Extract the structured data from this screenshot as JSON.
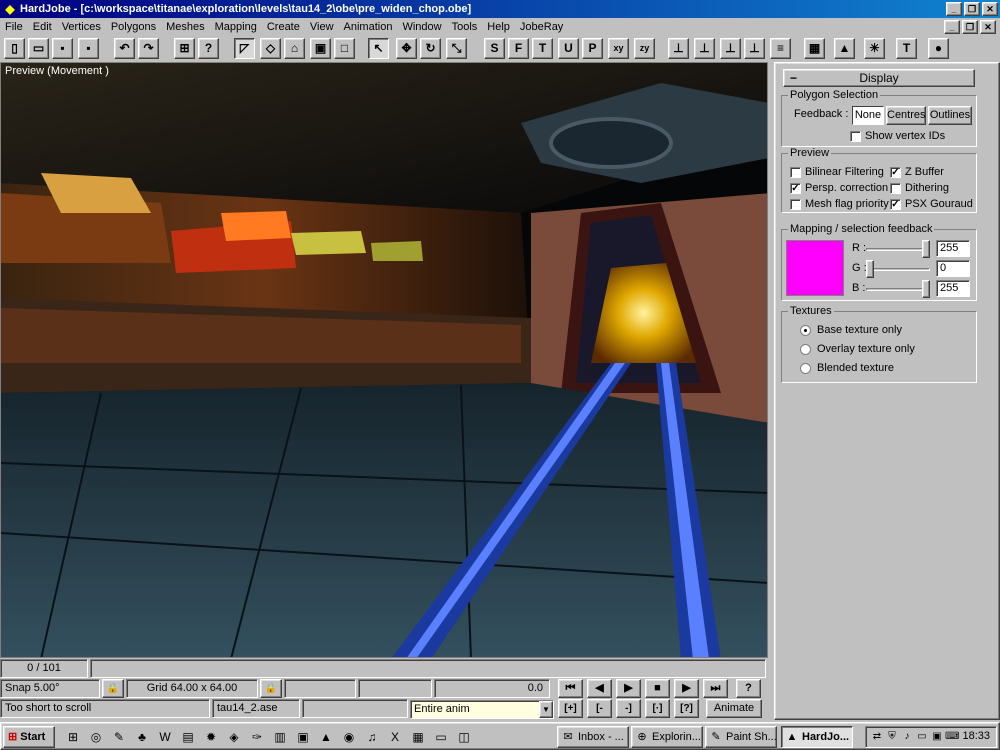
{
  "window": {
    "title": "HardJobe - [c:\\workspace\\titanae\\exploration\\levels\\tau14_2\\obe\\pre_widen_chop.obe]",
    "app_icon": "hardjobe-icon",
    "controls": [
      "_",
      "❐",
      "✕"
    ]
  },
  "menu": {
    "items": [
      "File",
      "Edit",
      "Vertices",
      "Polygons",
      "Meshes",
      "Mapping",
      "Create",
      "View",
      "Animation",
      "Window",
      "Tools",
      "Help",
      "JobeRay"
    ],
    "doc_controls": [
      "_",
      "❐",
      "✕"
    ]
  },
  "toolbar": {
    "buttons": [
      {
        "icon": "new-file-icon",
        "glyph": "▯"
      },
      {
        "icon": "open-folder-icon",
        "glyph": "▭"
      },
      {
        "icon": "save-icon",
        "glyph": "▪"
      },
      {
        "icon": "save-all-icon",
        "glyph": "▪"
      },
      {
        "icon": "undo-icon",
        "glyph": "↶"
      },
      {
        "icon": "redo-icon",
        "glyph": "↷"
      },
      {
        "icon": "texture-tree-icon",
        "glyph": "⊞"
      },
      {
        "icon": "help-query-icon",
        "glyph": "?"
      },
      {
        "icon": "polygon-draw-icon",
        "glyph": "◸"
      },
      {
        "icon": "quad-icon",
        "glyph": "◇"
      },
      {
        "icon": "house-icon",
        "glyph": "⌂"
      },
      {
        "icon": "cube-icon",
        "glyph": "▣"
      },
      {
        "icon": "box-icon",
        "glyph": "□"
      },
      {
        "icon": "select-arrow-icon",
        "glyph": "↖"
      },
      {
        "icon": "move-icon",
        "glyph": "✥"
      },
      {
        "icon": "rotate-icon",
        "glyph": "↻"
      },
      {
        "icon": "scale-icon",
        "glyph": "⤡"
      },
      {
        "icon": "view-s-icon",
        "glyph": "S"
      },
      {
        "icon": "view-f-icon",
        "glyph": "F"
      },
      {
        "icon": "view-t-icon",
        "glyph": "T"
      },
      {
        "icon": "view-u-icon",
        "glyph": "U"
      },
      {
        "icon": "view-p-icon",
        "glyph": "P"
      },
      {
        "icon": "view-xy-icon",
        "glyph": "xy"
      },
      {
        "icon": "view-zy-icon",
        "glyph": "zy"
      },
      {
        "icon": "axis-xy-icon",
        "glyph": "⊥"
      },
      {
        "icon": "axis-yz-icon",
        "glyph": "⊥"
      },
      {
        "icon": "axis-zx-icon",
        "glyph": "⊥"
      },
      {
        "icon": "axis-free-icon",
        "glyph": "⊥"
      },
      {
        "icon": "document-icon",
        "glyph": "≡"
      },
      {
        "icon": "texture-palette-icon",
        "glyph": "▦"
      },
      {
        "icon": "cone-icon",
        "glyph": "▲"
      },
      {
        "icon": "light-bulb-icon",
        "glyph": "☀"
      },
      {
        "icon": "hammer-icon",
        "glyph": "T"
      },
      {
        "icon": "sphere-icon",
        "glyph": "●"
      }
    ]
  },
  "viewport": {
    "label": "Preview (Movement )"
  },
  "panel": {
    "header": "Display",
    "polygon_selection": {
      "title": "Polygon Selection",
      "feedback_label": "Feedback :",
      "buttons": [
        "None",
        "Centres",
        "Outlines"
      ],
      "selected": "None",
      "show_vertex_ids": {
        "label": "Show vertex IDs",
        "checked": false
      }
    },
    "preview": {
      "title": "Preview",
      "options": [
        {
          "label": "Bilinear Filtering",
          "checked": false
        },
        {
          "label": "Z Buffer",
          "checked": true
        },
        {
          "label": "Persp. correction",
          "checked": true
        },
        {
          "label": "Dithering",
          "checked": false
        },
        {
          "label": "Mesh flag priority",
          "checked": false
        },
        {
          "label": "PSX Gouraud",
          "checked": true
        }
      ]
    },
    "mapping": {
      "title": "Mapping / selection feedback",
      "swatch_color": "#ff00ff",
      "channels": [
        {
          "label": "R :",
          "value": "255",
          "level": 1.0
        },
        {
          "label": "G :",
          "value": "0",
          "level": 0.0
        },
        {
          "label": "B :",
          "value": "255",
          "level": 1.0
        }
      ]
    },
    "textures": {
      "title": "Textures",
      "options": [
        "Base texture only",
        "Overlay texture only",
        "Blended texture"
      ],
      "selected": 0
    }
  },
  "timeline": {
    "frame": "0 / 101"
  },
  "status": {
    "snap": "Snap 5.00°",
    "grid": "Grid 64.00 x 64.00",
    "value": "0.0",
    "message": "Too short to scroll",
    "file": "tau14_2.ase",
    "anim_range": "Entire anim",
    "animate_label": "Animate",
    "help_label": "?"
  },
  "playback": {
    "buttons": [
      {
        "icon": "skip-to-start-icon",
        "glyph": "⏮"
      },
      {
        "icon": "step-back-icon",
        "glyph": "◀"
      },
      {
        "icon": "play-icon",
        "glyph": "▶"
      },
      {
        "icon": "stop-icon",
        "glyph": "■"
      },
      {
        "icon": "step-forward-icon",
        "glyph": "▶"
      },
      {
        "icon": "skip-to-end-icon",
        "glyph": "⏭"
      }
    ],
    "keys": [
      {
        "icon": "key-range-icon",
        "glyph": "[+]"
      },
      {
        "icon": "key-prev-icon",
        "glyph": "[-"
      },
      {
        "icon": "key-next-icon",
        "glyph": "-]"
      },
      {
        "icon": "key-all-icon",
        "glyph": "[·]"
      },
      {
        "icon": "key-query-icon",
        "glyph": "[?]"
      }
    ]
  },
  "taskbar": {
    "start_label": "Start",
    "quick_icons": [
      "windows-icon",
      "ie-icon",
      "paint-icon",
      "game-icon",
      "word-icon",
      "doc-icon",
      "gear-icon",
      "shield-icon",
      "pen-icon",
      "book-icon",
      "image-icon",
      "triangle-icon",
      "globe-icon",
      "media-icon",
      "excel-icon",
      "calc-icon",
      "folder-icon",
      "chip-icon"
    ],
    "tasks": [
      {
        "label": "Inbox - ...",
        "icon": "outlook-icon",
        "active": false
      },
      {
        "label": "Explorin...",
        "icon": "explorer-icon",
        "active": false
      },
      {
        "label": "Paint Sh...",
        "icon": "paintshop-icon",
        "active": false
      },
      {
        "label": "HardJo...",
        "icon": "hardjobe-task-icon",
        "active": true
      }
    ],
    "tray_icons": [
      "network-icon",
      "antivirus-icon",
      "speaker-icon",
      "display-icon",
      "monitor-icon",
      "keyboard-icon"
    ],
    "clock": "18:33"
  }
}
